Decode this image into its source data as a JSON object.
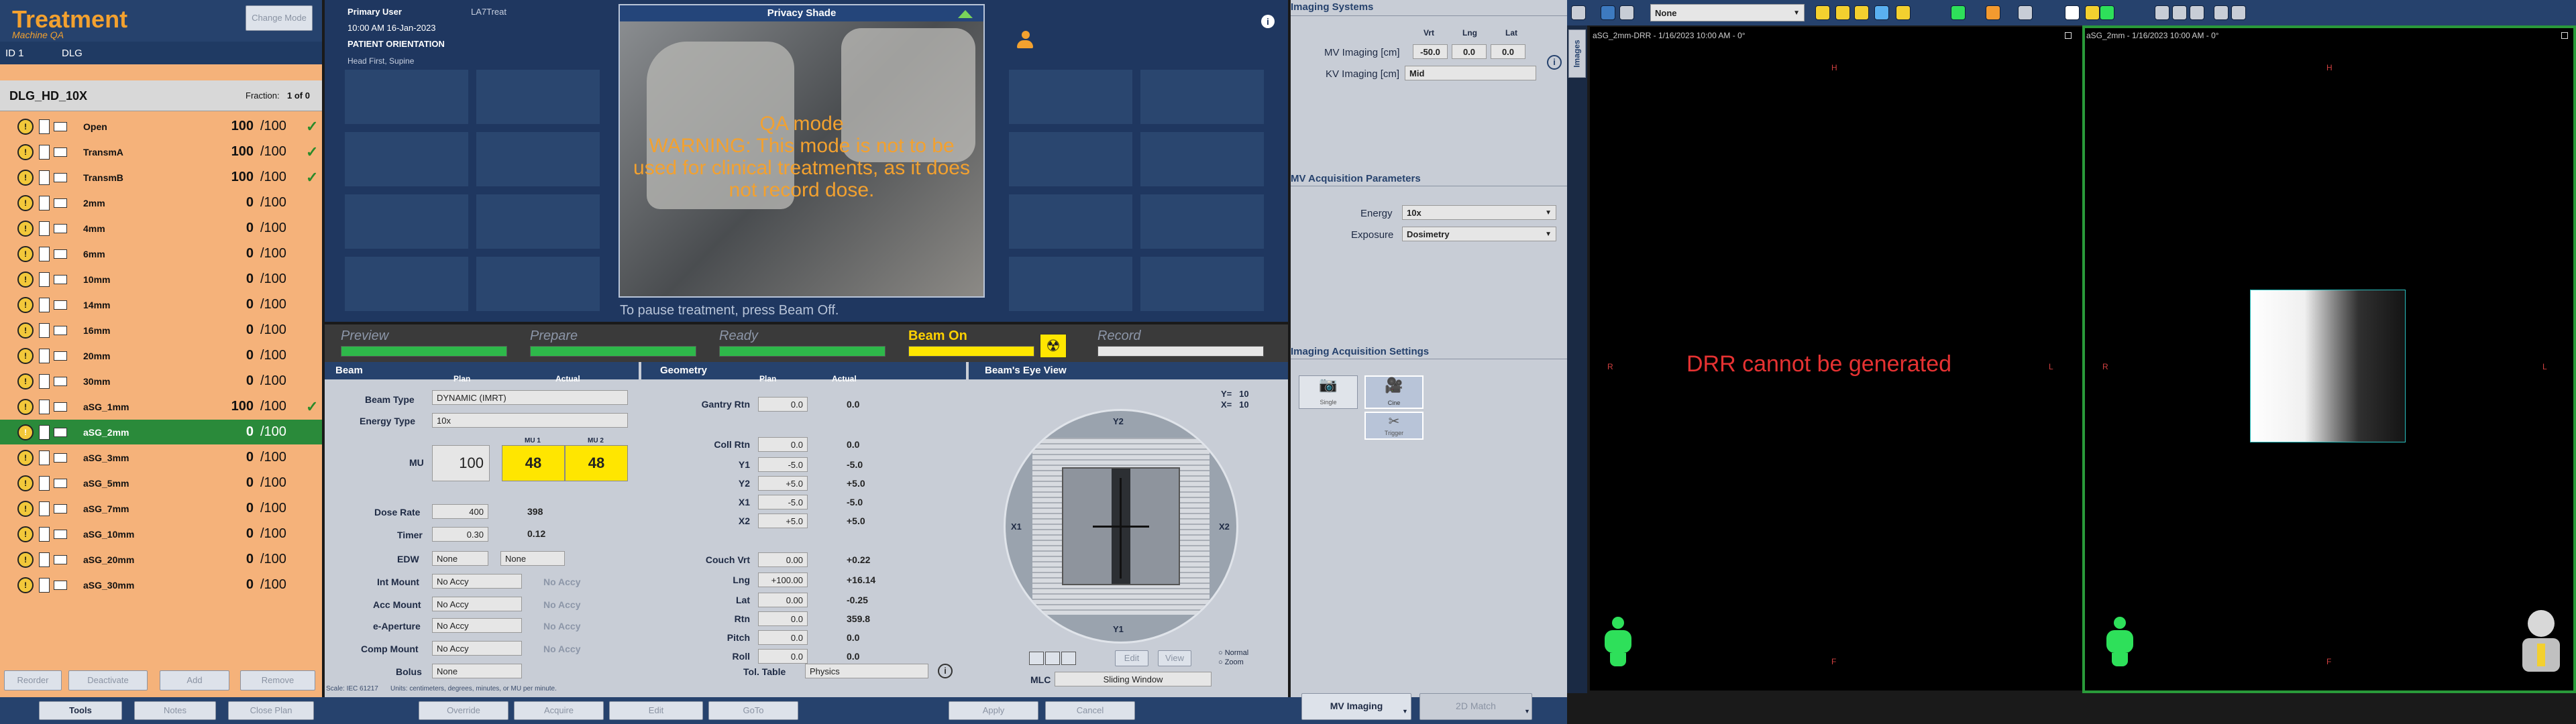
{
  "left_panel": {
    "title": "Treatment",
    "subtitle": "Machine QA",
    "change_mode_label": "Change Mode",
    "id_label": "ID 1",
    "id_value": "DLG",
    "plan_name": "DLG_HD_10X",
    "fraction_label": "Fraction:",
    "fraction_value": "1 of 0",
    "fields": [
      {
        "name": "Open",
        "mu": "100",
        "total": "/100",
        "done": true
      },
      {
        "name": "TransmA",
        "mu": "100",
        "total": "/100",
        "done": true
      },
      {
        "name": "TransmB",
        "mu": "100",
        "total": "/100",
        "done": true
      },
      {
        "name": "2mm",
        "mu": "0",
        "total": "/100",
        "done": false
      },
      {
        "name": "4mm",
        "mu": "0",
        "total": "/100",
        "done": false
      },
      {
        "name": "6mm",
        "mu": "0",
        "total": "/100",
        "done": false
      },
      {
        "name": "10mm",
        "mu": "0",
        "total": "/100",
        "done": false
      },
      {
        "name": "14mm",
        "mu": "0",
        "total": "/100",
        "done": false
      },
      {
        "name": "16mm",
        "mu": "0",
        "total": "/100",
        "done": false
      },
      {
        "name": "20mm",
        "mu": "0",
        "total": "/100",
        "done": false
      },
      {
        "name": "30mm",
        "mu": "0",
        "total": "/100",
        "done": false
      },
      {
        "name": "aSG_1mm",
        "mu": "100",
        "total": "/100",
        "done": true
      },
      {
        "name": "aSG_2mm",
        "mu": "0",
        "total": "/100",
        "done": false,
        "selected": true
      },
      {
        "name": "aSG_3mm",
        "mu": "0",
        "total": "/100",
        "done": false
      },
      {
        "name": "aSG_5mm",
        "mu": "0",
        "total": "/100",
        "done": false
      },
      {
        "name": "aSG_7mm",
        "mu": "0",
        "total": "/100",
        "done": false
      },
      {
        "name": "aSG_10mm",
        "mu": "0",
        "total": "/100",
        "done": false
      },
      {
        "name": "aSG_20mm",
        "mu": "0",
        "total": "/100",
        "done": false
      },
      {
        "name": "aSG_30mm",
        "mu": "0",
        "total": "/100",
        "done": false
      }
    ],
    "actions": [
      "Reorder",
      "Deactivate",
      "Add",
      "Remove"
    ]
  },
  "header": {
    "primary_user_label": "Primary User",
    "primary_user_value": "LA7Treat",
    "datetime": "10:00 AM 16-Jan-2023",
    "orientation_label": "PATIENT ORIENTATION",
    "orientation_value": "Head First, Supine",
    "privacy_shade": "Privacy Shade",
    "qa_mode_title": "QA mode",
    "qa_warning": "WARNING: This mode is not to be used for clinical treatments, as it does not record dose.",
    "pause_hint": "To pause treatment, press Beam Off."
  },
  "states": [
    {
      "label": "Preview",
      "active": false
    },
    {
      "label": "Prepare",
      "active": false
    },
    {
      "label": "Ready",
      "active": false
    },
    {
      "label": "Beam On",
      "active": true
    },
    {
      "label": "Record",
      "active": false
    }
  ],
  "beam": {
    "section_title": "Beam",
    "plan_col": "Plan",
    "actual_col": "Actual",
    "beam_type_label": "Beam Type",
    "beam_type_value": "DYNAMIC (IMRT)",
    "energy_type_label": "Energy Type",
    "energy_type_value": "10x",
    "mu_label": "MU",
    "mu_plan": "100",
    "mu1_label": "MU 1",
    "mu2_label": "MU 2",
    "mu1_value": "48",
    "mu2_value": "48",
    "dose_rate_label": "Dose Rate",
    "dose_rate_plan": "400",
    "dose_rate_actual": "398",
    "timer_label": "Timer",
    "timer_plan": "0.30",
    "timer_actual": "0.12",
    "edw_label": "EDW",
    "edw_plan": "None",
    "edw_actual": "None",
    "int_mount_label": "Int Mount",
    "int_mount_plan": "No Accy",
    "int_mount_actual": "No Accy",
    "acc_mount_label": "Acc Mount",
    "acc_mount_plan": "No Accy",
    "acc_mount_actual": "No Accy",
    "e_aperture_label": "e-Aperture",
    "e_aperture_plan": "No Accy",
    "e_aperture_actual": "No Accy",
    "comp_mount_label": "Comp Mount",
    "comp_mount_plan": "No Accy",
    "comp_mount_actual": "No Accy",
    "bolus_label": "Bolus",
    "bolus_value": "None",
    "scale_note": "Scale: IEC 61217",
    "units_note": "Units: centimeters, degrees, minutes, or MU per minute."
  },
  "geometry": {
    "section_title": "Geometry",
    "plan_col": "Plan",
    "actual_col": "Actual",
    "gantry_rtn_label": "Gantry Rtn",
    "gantry_rtn_plan": "0.0",
    "gantry_rtn_actual": "0.0",
    "coll_rtn_label": "Coll Rtn",
    "coll_rtn_plan": "0.0",
    "coll_rtn_actual": "0.0",
    "y1_label": "Y1",
    "y1_plan": "-5.0",
    "y1_actual": "-5.0",
    "y2_label": "Y2",
    "y2_plan": "+5.0",
    "y2_actual": "+5.0",
    "x1_label": "X1",
    "x1_plan": "-5.0",
    "x1_actual": "-5.0",
    "x2_label": "X2",
    "x2_plan": "+5.0",
    "x2_actual": "+5.0",
    "couch_vrt_label": "Couch Vrt",
    "couch_vrt_plan": "0.00",
    "couch_vrt_actual": "+0.22",
    "lng_label": "Lng",
    "lng_plan": "+100.00",
    "lng_actual": "+16.14",
    "lat_label": "Lat",
    "lat_plan": "0.00",
    "lat_actual": "-0.25",
    "rtn_label": "Rtn",
    "rtn_plan": "0.0",
    "rtn_actual": "359.8",
    "pitch_label": "Pitch",
    "pitch_plan": "0.0",
    "pitch_actual": "0.0",
    "roll_label": "Roll",
    "roll_plan": "0.0",
    "roll_actual": "0.0",
    "tol_table_label": "Tol. Table",
    "tol_table_value": "Physics"
  },
  "bev": {
    "title": "Beam's Eye View",
    "y_readout": "Y=   10",
    "x_readout": "X=   10",
    "y1": "Y1",
    "y2": "Y2",
    "x1": "X1",
    "x2": "X2",
    "edit_label": "Edit",
    "view_label": "View",
    "normal_label": "Normal",
    "zoom_label": "Zoom",
    "mlc_label": "MLC",
    "mlc_value": "Sliding Window"
  },
  "imaging": {
    "systems_title": "Imaging Systems",
    "vrt_col": "Vrt",
    "lng_col": "Lng",
    "lat_col": "Lat",
    "mv_label": "MV Imaging [cm]",
    "mv_vrt": "-50.0",
    "mv_lng": "0.0",
    "mv_lat": "0.0",
    "kv_label": "KV Imaging [cm]",
    "kv_value": "Mid",
    "mv_acq_title": "MV Acquisition Parameters",
    "energy_label": "Energy",
    "energy_value": "10x",
    "exposure_label": "Exposure",
    "exposure_value": "Dosimetry",
    "acq_settings_title": "Imaging Acquisition Settings",
    "single_label": "Single",
    "cine_label": "Cine",
    "trigger_label": "Trigger",
    "images_tab": "Images"
  },
  "viewer": {
    "dropdown_value": "None",
    "left_title": "aSG_2mm-DRR - 1/16/2023 10:00 AM - 0°",
    "right_title": "aSG_2mm - 1/16/2023 10:00 AM - 0°",
    "drr_message": "DRR cannot be generated",
    "h": "H",
    "f": "F",
    "r": "R",
    "l": "L"
  },
  "bottom": {
    "tools": "Tools",
    "notes": "Notes",
    "close_plan": "Close Plan",
    "override": "Override",
    "acquire": "Acquire",
    "edit": "Edit",
    "goto": "GoTo",
    "apply": "Apply",
    "cancel": "Cancel",
    "mv_imaging": "MV Imaging",
    "match_2d": "2D Match"
  }
}
